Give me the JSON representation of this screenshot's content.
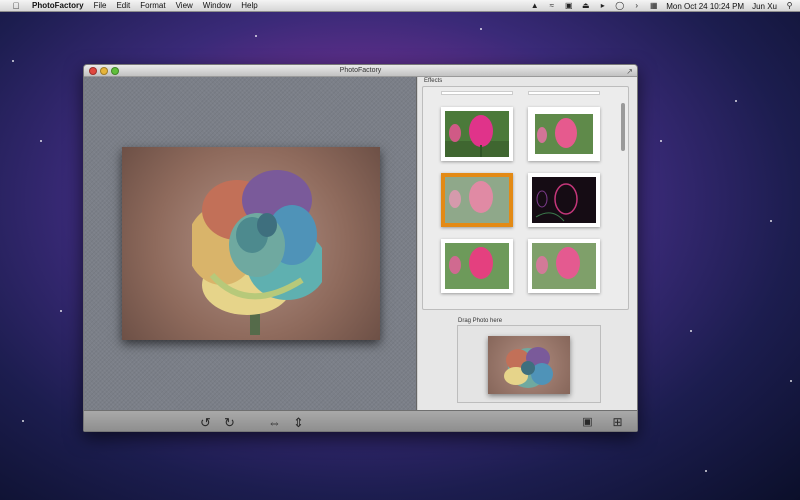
{
  "menubar": {
    "app_name": "PhotoFactory",
    "menus": [
      "File",
      "Edit",
      "Format",
      "View",
      "Window",
      "Help"
    ],
    "clock": "Mon Oct 24  10:24 PM",
    "user": "Jun Xu"
  },
  "window": {
    "title": "PhotoFactory"
  },
  "effects": {
    "label": "Effects"
  },
  "drop": {
    "label": "Drag Photo here"
  },
  "icons": {
    "apple": "apple-icon",
    "rotate_left": "rotate-left-icon",
    "rotate_right": "rotate-right-icon",
    "flip_horizontal": "flip-horizontal-icon",
    "flip_vertical": "flip-vertical-icon",
    "save": "save-icon",
    "crop": "crop-icon"
  },
  "colors": {
    "selection": "#e38a15",
    "tulip": "#e05a86"
  }
}
